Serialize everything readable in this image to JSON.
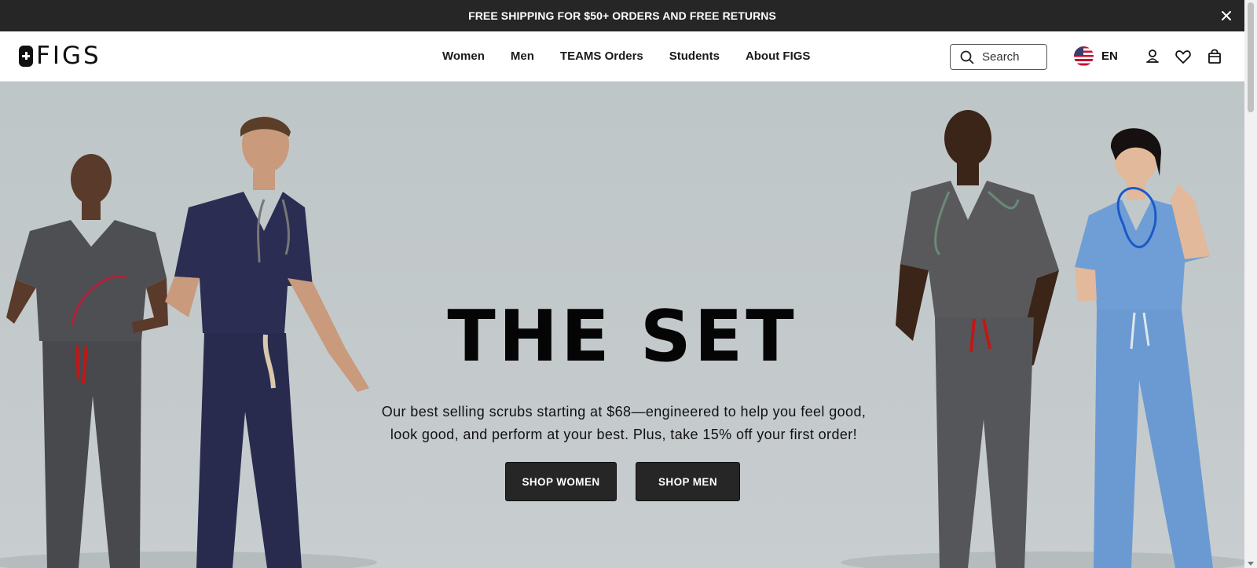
{
  "announcement": {
    "text": "FREE SHIPPING FOR $50+ ORDERS AND FREE RETURNS",
    "close_icon": "close-icon"
  },
  "header": {
    "logo_text": "FIGS",
    "nav": [
      {
        "label": "Women"
      },
      {
        "label": "Men"
      },
      {
        "label": "TEAMS Orders"
      },
      {
        "label": "Students"
      },
      {
        "label": "About FIGS"
      }
    ],
    "search": {
      "placeholder": "Search",
      "icon": "search-icon"
    },
    "language": {
      "label": "EN",
      "flag": "us-flag-icon"
    },
    "icons": [
      "account-icon",
      "heart-icon",
      "shopping-bag-icon"
    ]
  },
  "hero": {
    "title": "THE SET",
    "copy_line1": "Our best selling scrubs starting at $68—engineered to help you feel good,",
    "copy_line2": "look good, and perform at your best. Plus, take 15% off your first order!",
    "buttons": {
      "shop_women": "SHOP WOMEN",
      "shop_men": "SHOP MEN"
    }
  },
  "colors": {
    "announcement_bg": "#262626",
    "hero_bg": "#c0c8ca",
    "button_bg": "#262626",
    "scrub_charcoal": "#4e4f53",
    "scrub_navy": "#2b2d52",
    "scrub_ceil_blue": "#6f9ed6"
  }
}
